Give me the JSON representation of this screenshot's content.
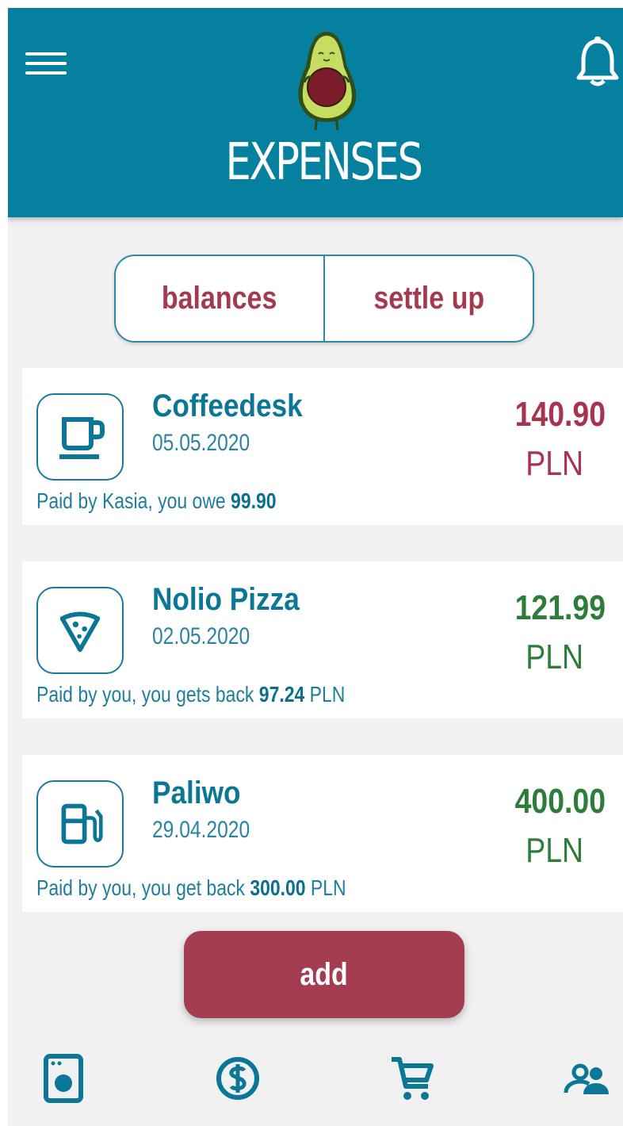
{
  "header": {
    "title": "EXPENSES",
    "menu_icon": "hamburger-menu-icon",
    "notification_icon": "bell-icon",
    "logo": "avocado-mascot-logo"
  },
  "segments": [
    {
      "label": "balances"
    },
    {
      "label": "settle up"
    }
  ],
  "expenses": [
    {
      "name": "Coffeedesk",
      "date": "05.05.2020",
      "icon": "coffee-cup-icon",
      "amount": "140.90",
      "currency": "PLN",
      "amount_color": "#a7334e",
      "note_prefix": "Paid by Kasia, you owe ",
      "note_value": "99.90",
      "note_suffix": ""
    },
    {
      "name": "Nolio Pizza",
      "date": "02.05.2020",
      "icon": "pizza-slice-icon",
      "amount": "121.99",
      "currency": "PLN",
      "amount_color": "#2d7d3a",
      "note_prefix": "Paid by you, you gets back ",
      "note_value": "97.24",
      "note_suffix": " PLN"
    },
    {
      "name": "Paliwo",
      "date": "29.04.2020",
      "icon": "fuel-pump-icon",
      "amount": "400.00",
      "currency": "PLN",
      "amount_color": "#2d7d3a",
      "note_prefix": "Paid by you, you get back ",
      "note_value": "300.00",
      "note_suffix": " PLN"
    }
  ],
  "add_button": {
    "label": "add"
  },
  "bottom_nav": [
    {
      "icon": "washing-machine-icon"
    },
    {
      "icon": "dollar-coin-icon"
    },
    {
      "icon": "shopping-cart-icon"
    },
    {
      "icon": "people-icon"
    }
  ],
  "colors": {
    "header": "#06809f",
    "accent_red": "#a43d52",
    "positive_green": "#2d7d3a",
    "text_blue": "#0c7697",
    "background": "#f1f1f1"
  }
}
